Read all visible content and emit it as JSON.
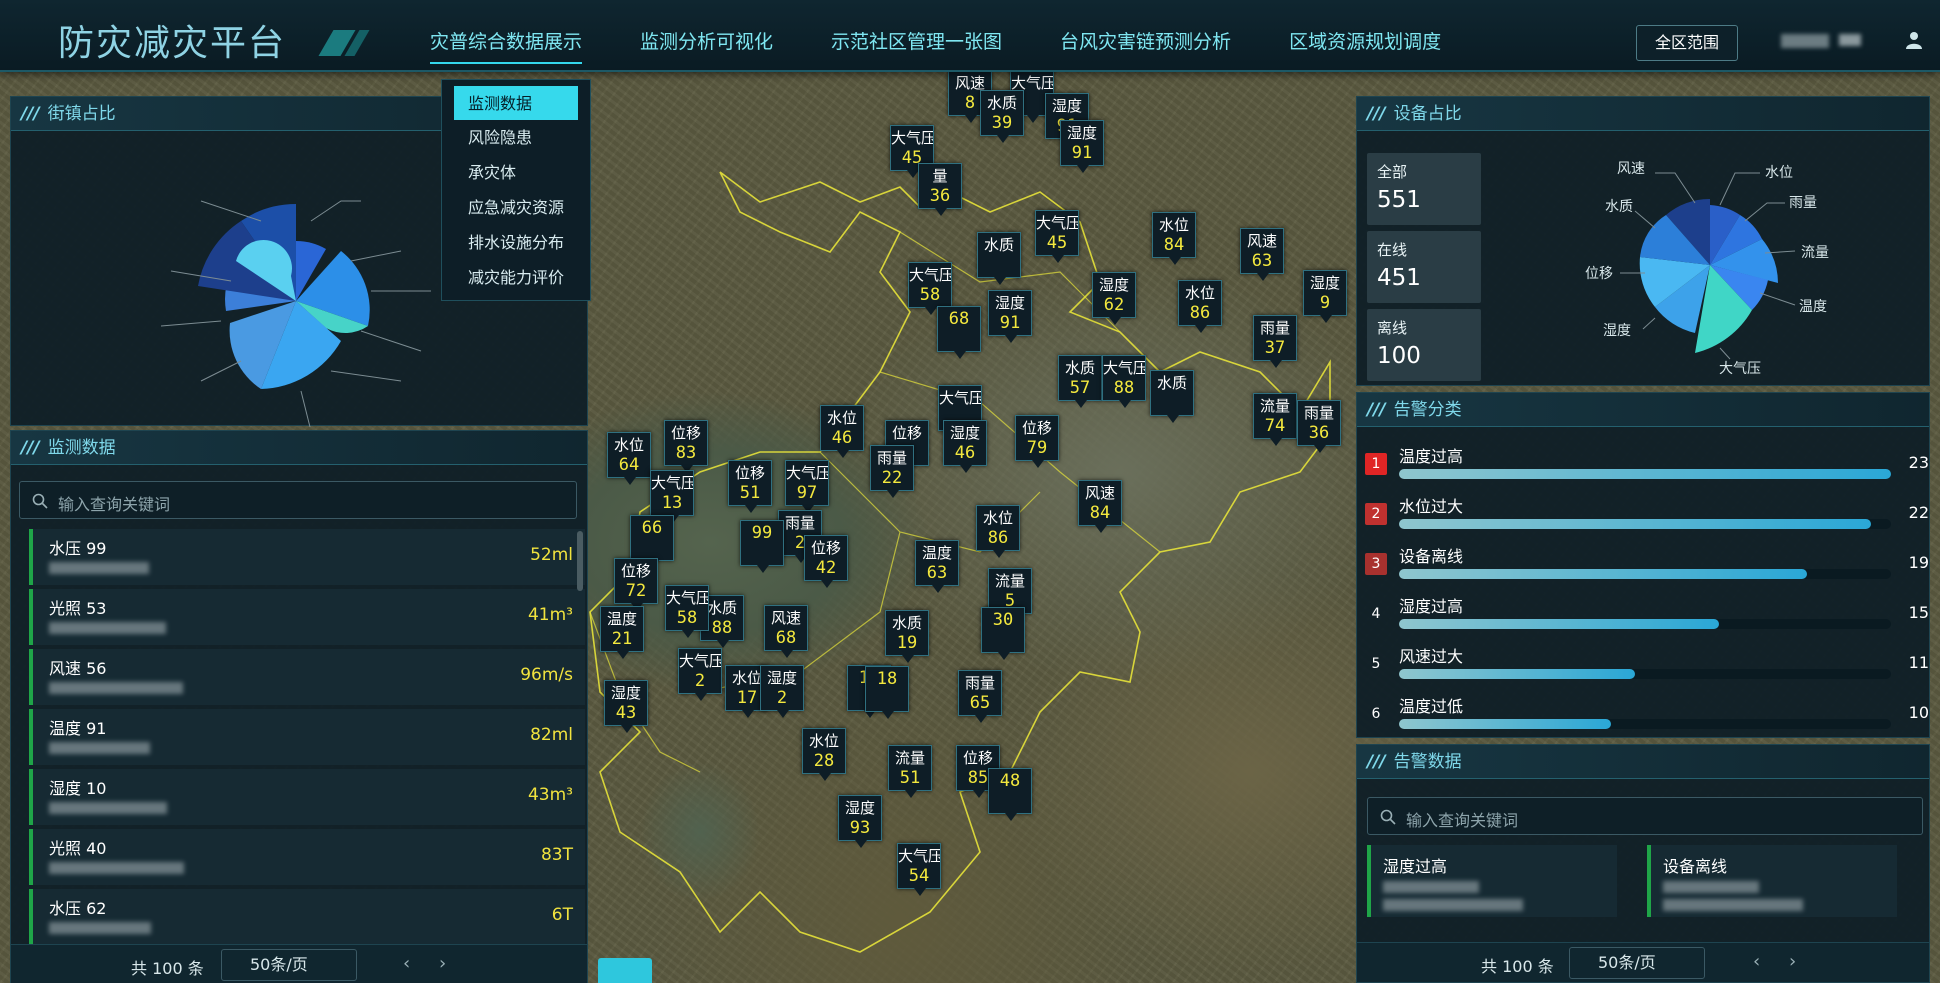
{
  "header": {
    "title": "防灾减灾平台",
    "nav": [
      "灾普综合数据展示",
      "监测分析可视化",
      "示范社区管理一张图",
      "台风灾害链预测分析",
      "区域资源规划调度"
    ],
    "active_nav": 0,
    "scope_button": "全区范围"
  },
  "dropdown": {
    "items": [
      "监测数据",
      "风险隐患",
      "承灾体",
      "应急减灾资源",
      "排水设施分布",
      "减灾能力评价"
    ],
    "selected": 0
  },
  "left": {
    "street_title": "街镇占比",
    "monitor_title": "监测数据",
    "search_placeholder": "输入查询关键词",
    "rows": [
      {
        "name": "水压 99",
        "value": "52ml"
      },
      {
        "name": "光照 53",
        "value": "41m³"
      },
      {
        "name": "风速 56",
        "value": "96m/s"
      },
      {
        "name": "温度 91",
        "value": "82ml"
      },
      {
        "name": "湿度 10",
        "value": "43m³"
      },
      {
        "name": "光照 40",
        "value": "83T"
      },
      {
        "name": "水压 62",
        "value": "6T"
      }
    ],
    "pager": {
      "total": "共 100 条",
      "size": "50条/页"
    }
  },
  "right": {
    "device_title": "设备占比",
    "stats": [
      {
        "label": "全部",
        "value": "551"
      },
      {
        "label": "在线",
        "value": "451"
      },
      {
        "label": "离线",
        "value": "100"
      }
    ],
    "device_labels": [
      "风速",
      "水位",
      "雨量",
      "水质",
      "流量",
      "位移",
      "温度",
      "湿度",
      "大气压"
    ],
    "alarm_title": "告警分类",
    "alarms": [
      {
        "rank": "1",
        "name": "温度过高",
        "count": "23",
        "ratio": 1.0,
        "color": "#e02525"
      },
      {
        "rank": "2",
        "name": "水位过大",
        "count": "22",
        "ratio": 0.96,
        "color": "#c0312f"
      },
      {
        "rank": "3",
        "name": "设备离线",
        "count": "19",
        "ratio": 0.83,
        "color": "#a8312e"
      },
      {
        "rank": "4",
        "name": "湿度过高",
        "count": "15",
        "ratio": 0.65,
        "color": ""
      },
      {
        "rank": "5",
        "name": "风速过大",
        "count": "11",
        "ratio": 0.48,
        "color": ""
      },
      {
        "rank": "6",
        "name": "温度过低",
        "count": "10",
        "ratio": 0.43,
        "color": ""
      }
    ],
    "alarm_data_title": "告警数据",
    "search_placeholder": "输入查询关键词",
    "cards": [
      {
        "name": "湿度过高"
      },
      {
        "name": "设备离线"
      }
    ],
    "pager": {
      "total": "共 100 条",
      "size": "50条/页"
    }
  },
  "markers": [
    {
      "t": "风速",
      "v": "8"
    },
    {
      "t": "大气压",
      "v": ""
    },
    {
      "t": "水质",
      "v": "39"
    },
    {
      "t": "湿度",
      "v": "91"
    },
    {
      "t": "湿度",
      "v": "91"
    },
    {
      "t": "大气压",
      "v": "45"
    },
    {
      "t": "量",
      "v": "36"
    },
    {
      "t": "大气压",
      "v": "45"
    },
    {
      "t": "水位",
      "v": "84"
    },
    {
      "t": "风速",
      "v": "63"
    },
    {
      "t": "水质",
      "v": ""
    },
    {
      "t": "大气压",
      "v": "58"
    },
    {
      "t": "湿度",
      "v": "91"
    },
    {
      "t": "",
      "v": "68"
    },
    {
      "t": "湿度",
      "v": "62"
    },
    {
      "t": "水位",
      "v": "86"
    },
    {
      "t": "湿度",
      "v": "9"
    },
    {
      "t": "雨量",
      "v": "37"
    },
    {
      "t": "水质",
      "v": "57"
    },
    {
      "t": "大气压",
      "v": "88"
    },
    {
      "t": "水质",
      "v": ""
    },
    {
      "t": "流量",
      "v": "74"
    },
    {
      "t": "雨量",
      "v": "36"
    },
    {
      "t": "大气压",
      "v": ""
    },
    {
      "t": "湿度",
      "v": "46"
    },
    {
      "t": "位移",
      "v": "79"
    },
    {
      "t": "水位",
      "v": "64"
    },
    {
      "t": "位移",
      "v": "83"
    },
    {
      "t": "大气压",
      "v": "13"
    },
    {
      "t": "位移",
      "v": "51"
    },
    {
      "t": "大气压",
      "v": "97"
    },
    {
      "t": "水位",
      "v": "46"
    },
    {
      "t": "位移",
      "v": ""
    },
    {
      "t": "雨量",
      "v": "22"
    },
    {
      "t": "风速",
      "v": "84"
    },
    {
      "t": "",
      "v": "66"
    },
    {
      "t": "雨量",
      "v": "2"
    },
    {
      "t": "",
      "v": "99"
    },
    {
      "t": "位移",
      "v": "42"
    },
    {
      "t": "水位",
      "v": "86"
    },
    {
      "t": "温度",
      "v": "63"
    },
    {
      "t": "位移",
      "v": "72"
    },
    {
      "t": "流量",
      "v": "5"
    },
    {
      "t": "",
      "v": "30"
    },
    {
      "t": "温度",
      "v": "21"
    },
    {
      "t": "水质",
      "v": "88"
    },
    {
      "t": "风速",
      "v": "68"
    },
    {
      "t": "水质",
      "v": "19"
    },
    {
      "t": "大气压",
      "v": "2"
    },
    {
      "t": "水位",
      "v": "17"
    },
    {
      "t": "湿度",
      "v": "2"
    },
    {
      "t": "",
      "v": "10"
    },
    {
      "t": "湿度",
      "v": "43"
    },
    {
      "t": "雨量",
      "v": "65"
    },
    {
      "t": "",
      "v": "18"
    },
    {
      "t": "水位",
      "v": "28"
    },
    {
      "t": "流量",
      "v": "51"
    },
    {
      "t": "位移",
      "v": "85"
    },
    {
      "t": "湿度",
      "v": "93"
    },
    {
      "t": "",
      "v": "48"
    },
    {
      "t": "大气压",
      "v": "54"
    },
    {
      "t": "大气压",
      "v": "58"
    }
  ]
}
